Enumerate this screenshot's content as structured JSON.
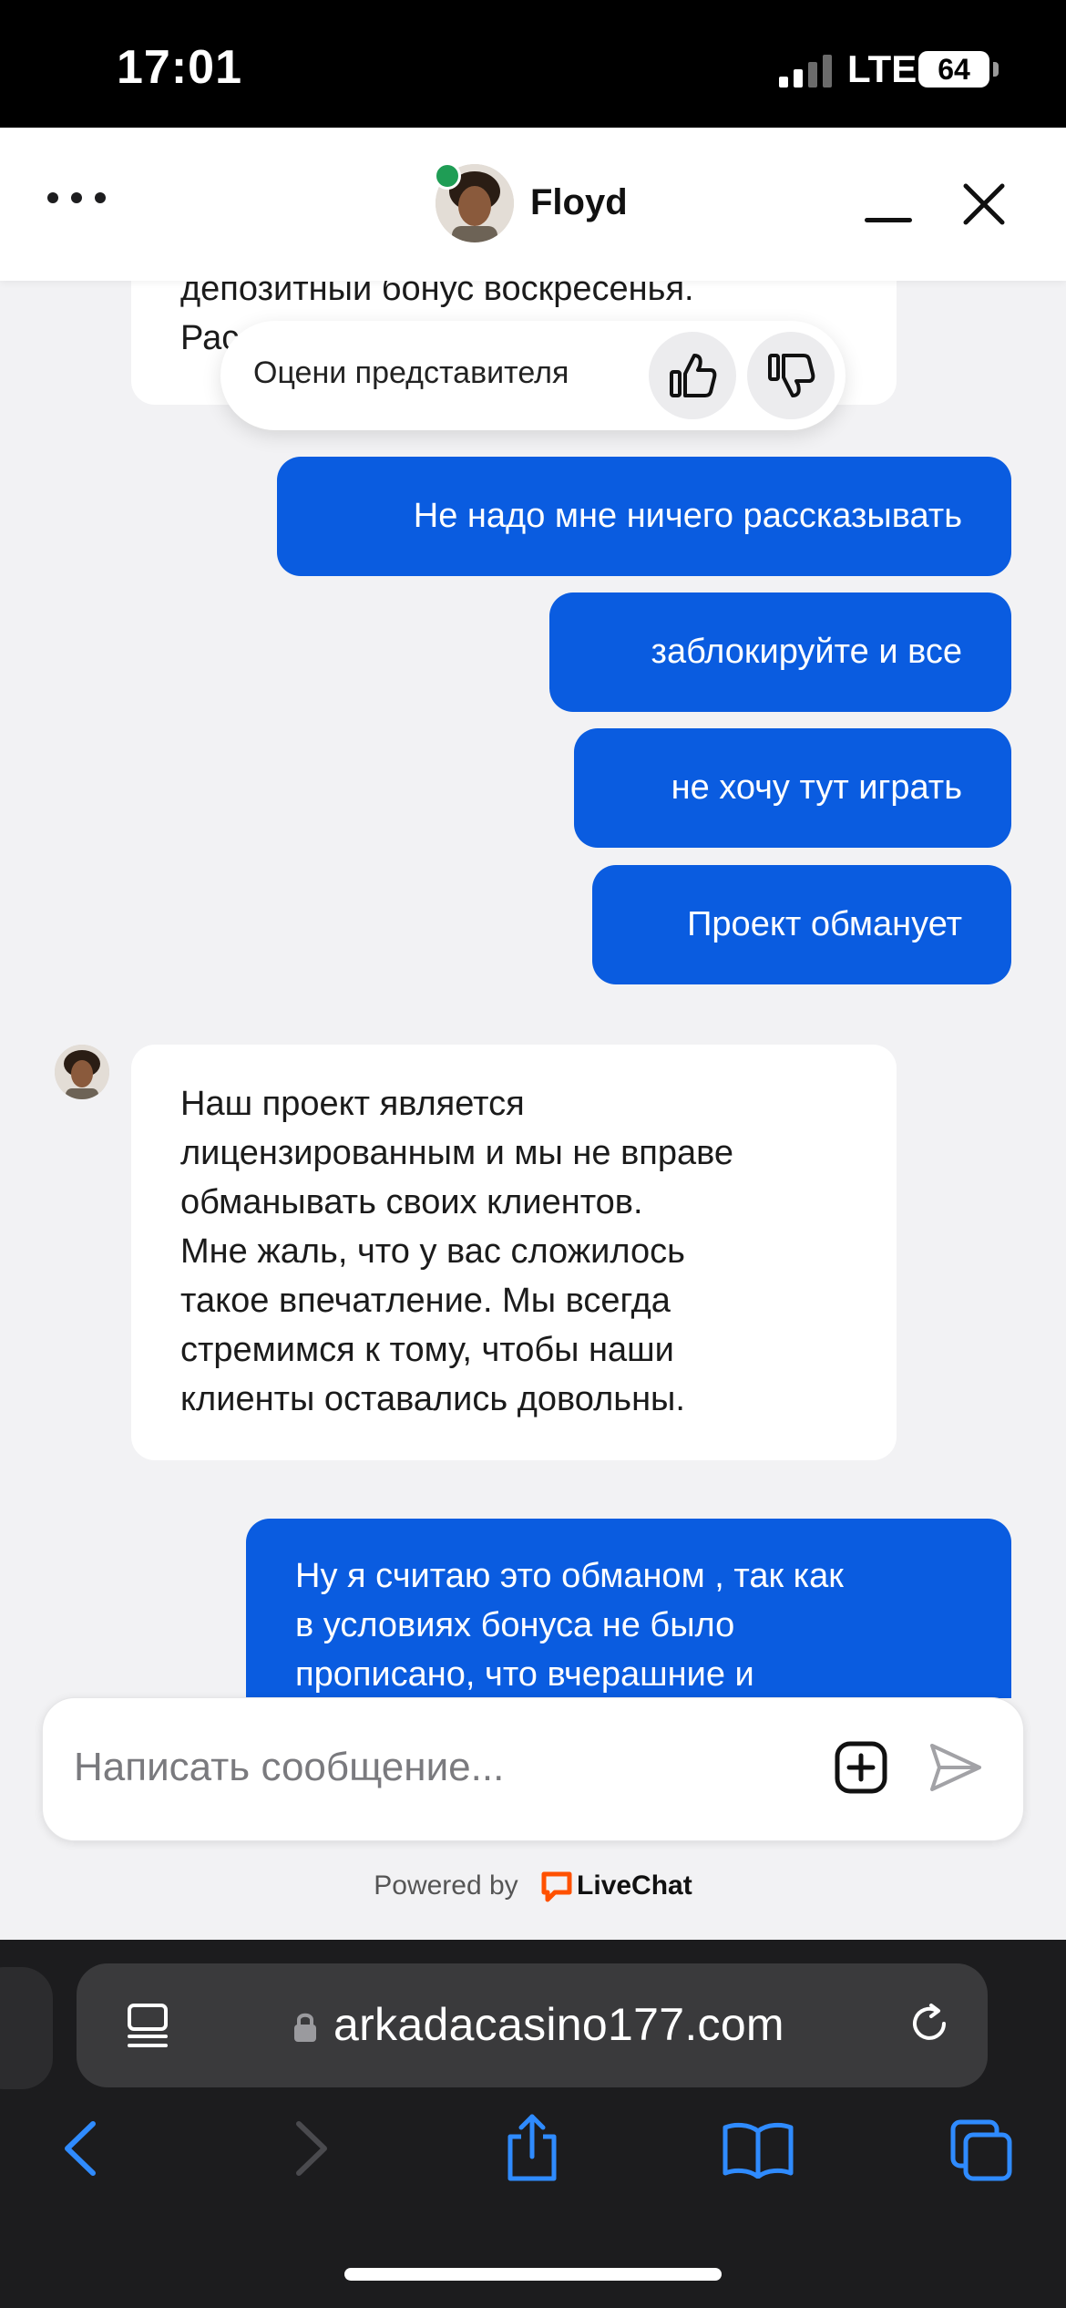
{
  "status_bar": {
    "time": "17:01",
    "network": "LTE",
    "battery": "64"
  },
  "header": {
    "agent_name": "Floyd",
    "online": true
  },
  "colors": {
    "accent": "#0a5ce0",
    "online": "#1f9d55",
    "livechat": "#ff5100"
  },
  "rating": {
    "label": "Оцени представителя"
  },
  "messages": {
    "top_agent": {
      "line1": "депозитный бонус воскресенья.",
      "line2": "Рас"
    },
    "v1": "Не надо мне ничего рассказывать",
    "v2": "заблокируйте и все",
    "v3": "не хочу тут играть",
    "v4": "Проект обманует",
    "agent_reply": {
      "l1": "Наш проект является",
      "l2": "лицензированным и мы не вправе",
      "l3": "обманывать своих клиентов.",
      "l4": "Мне жаль, что у вас сложилось",
      "l5": "такое впечатление. Мы всегда",
      "l6": "стремимся к тому, чтобы наши",
      "l7": "клиенты оставались довольны."
    },
    "v5": {
      "l1": "Ну я считаю это обманом , так как",
      "l2": "в условиях бонуса не было",
      "l3": "прописано, что вчерашние и"
    }
  },
  "composer": {
    "placeholder": "Написать сообщение..."
  },
  "footer": {
    "powered_by": "Powered by",
    "brand": "LiveChat"
  },
  "browser": {
    "url": "arkadacasino177.com"
  }
}
